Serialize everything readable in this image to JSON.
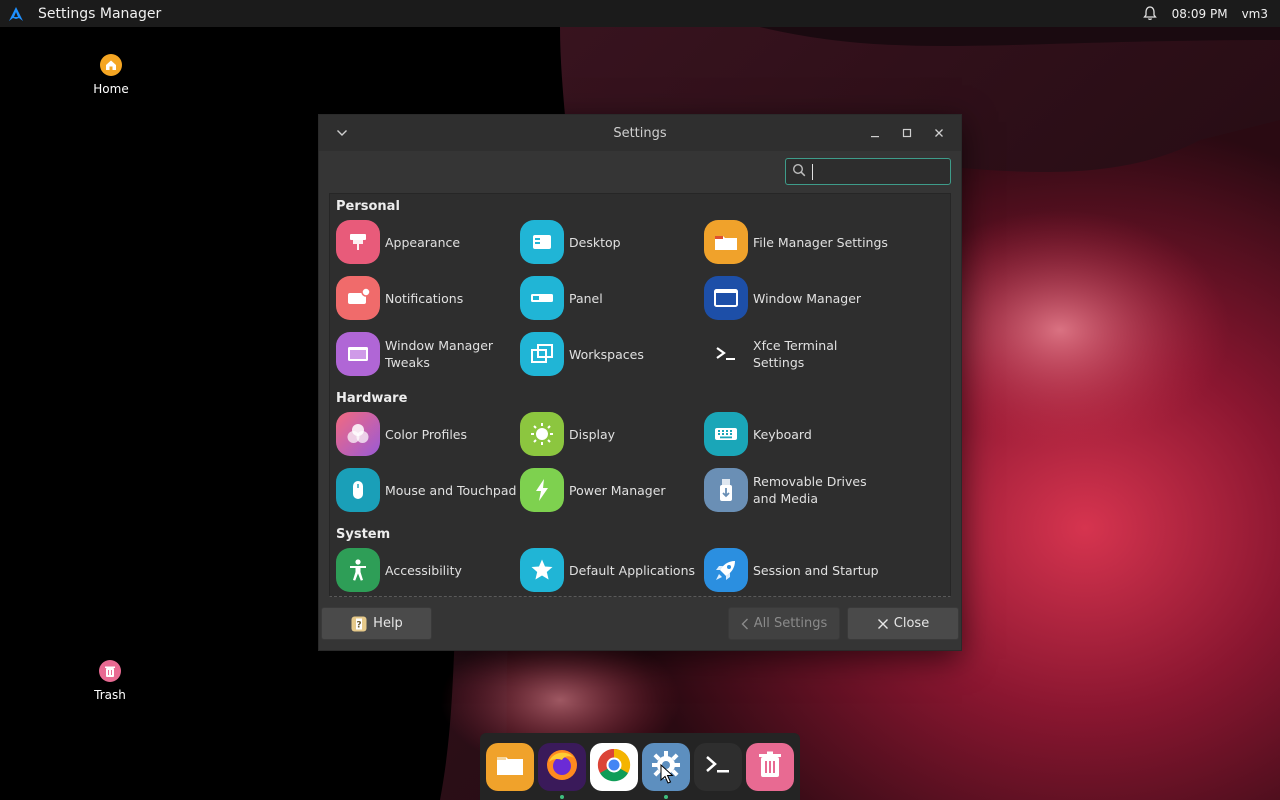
{
  "topbar": {
    "app_title": "Settings Manager",
    "clock": "08:09 PM",
    "user": "vm3",
    "launcher_icon": "arch-logo-icon",
    "notification_icon": "bell-icon"
  },
  "desktop": {
    "icons": [
      {
        "label": "Home",
        "icon": "home-icon"
      },
      {
        "label": "Trash",
        "icon": "trash-icon"
      }
    ]
  },
  "window": {
    "title": "Settings",
    "search": {
      "placeholder": "",
      "value": ""
    },
    "sections": [
      {
        "title": "Personal",
        "items": [
          {
            "label": "Appearance",
            "icon": "appearance-icon",
            "color": "#e85b7a"
          },
          {
            "label": "Desktop",
            "icon": "desktop-icon",
            "color": "#20b5d6"
          },
          {
            "label": "File Manager Settings",
            "icon": "folder-icon",
            "color": "#f0a22b"
          },
          {
            "label": "Notifications",
            "icon": "notifications-icon",
            "color": "#f06b6b"
          },
          {
            "label": "Panel",
            "icon": "panel-icon",
            "color": "#20b5d6"
          },
          {
            "label": "Window Manager",
            "icon": "window-manager-icon",
            "color": "#1d4fa8"
          },
          {
            "label": "Window Manager Tweaks",
            "icon": "window-tweaks-icon",
            "color": "#b066d6"
          },
          {
            "label": "Workspaces",
            "icon": "workspaces-icon",
            "color": "#20b5d6"
          },
          {
            "label": "Xfce Terminal Settings",
            "icon": "terminal-icon",
            "color": "#2e2e2e"
          }
        ]
      },
      {
        "title": "Hardware",
        "items": [
          {
            "label": "Color Profiles",
            "icon": "color-profiles-icon",
            "color": "#9a5ad6"
          },
          {
            "label": "Display",
            "icon": "display-icon",
            "color": "#8cc63f"
          },
          {
            "label": "Keyboard",
            "icon": "keyboard-icon",
            "color": "#1aa6b8"
          },
          {
            "label": "Mouse and Touchpad",
            "icon": "mouse-icon",
            "color": "#1a9fb8"
          },
          {
            "label": "Power Manager",
            "icon": "power-icon",
            "color": "#7ed14f"
          },
          {
            "label": "Removable Drives and Media",
            "icon": "usb-drive-icon",
            "color": "#6a8fb5"
          }
        ]
      },
      {
        "title": "System",
        "items": [
          {
            "label": "Accessibility",
            "icon": "accessibility-icon",
            "color": "#2e9e57"
          },
          {
            "label": "Default Applications",
            "icon": "star-icon",
            "color": "#20b5d6"
          },
          {
            "label": "Session and Startup",
            "icon": "rocket-icon",
            "color": "#2b8fe0"
          }
        ]
      }
    ],
    "footer": {
      "help_label": "Help",
      "all_settings_label": "All Settings",
      "close_label": "Close"
    }
  },
  "dock": {
    "items": [
      {
        "name": "Files",
        "icon": "files-icon",
        "running": false
      },
      {
        "name": "Firefox",
        "icon": "firefox-icon",
        "running": true
      },
      {
        "name": "Chrome",
        "icon": "chrome-icon",
        "running": false
      },
      {
        "name": "Settings",
        "icon": "settings-gear-icon",
        "running": true
      },
      {
        "name": "Terminal",
        "icon": "terminal-icon",
        "running": false
      },
      {
        "name": "Trash",
        "icon": "trash-icon",
        "running": false
      }
    ]
  }
}
